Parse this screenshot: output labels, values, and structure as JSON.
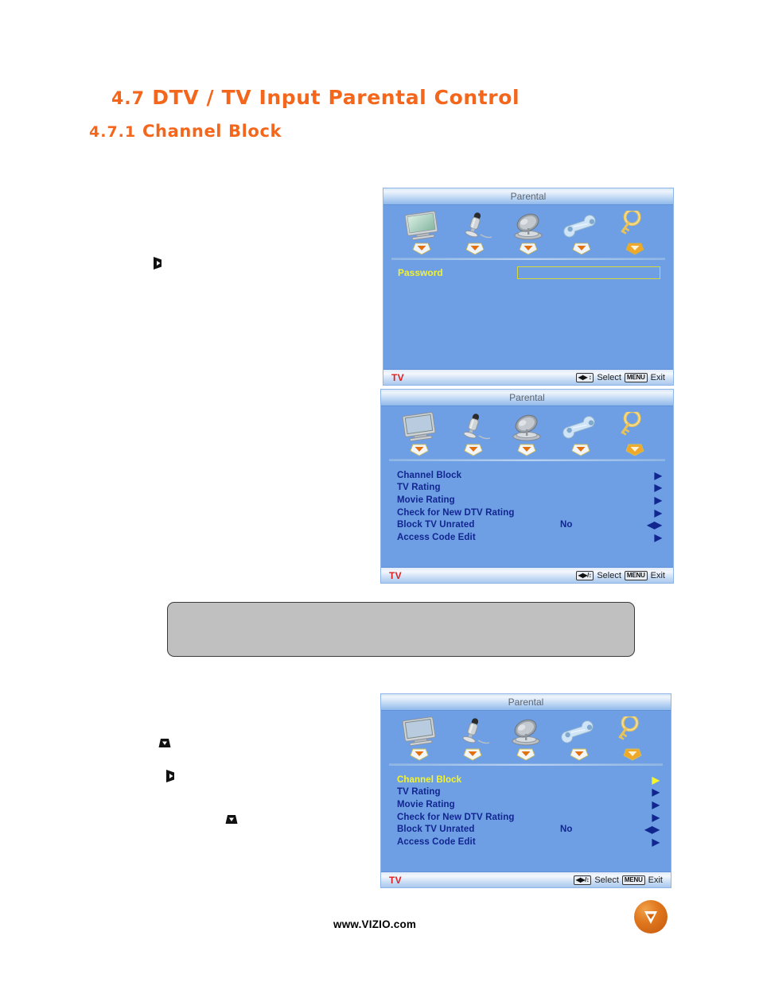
{
  "document": {
    "section_heading": {
      "number": "4.7",
      "text": "DTV / TV Input Parental Control"
    },
    "subsection_heading": {
      "number": "4.7.1",
      "text": "Channel Block"
    },
    "note_box_text": "",
    "footer": {
      "url": "www.VIZIO.com",
      "logo_letter": "V"
    }
  },
  "osd_panels": [
    {
      "id": "password-panel",
      "title": "Parental",
      "icons": [
        {
          "name": "tv-monitor-icon",
          "label": "TV"
        },
        {
          "name": "microphone-icon",
          "label": "Audio"
        },
        {
          "name": "satellite-dish-icon",
          "label": "Tuner"
        },
        {
          "name": "wrench-icon",
          "label": "Setup"
        },
        {
          "name": "key-icon",
          "label": "Parental",
          "selected": true
        }
      ],
      "password": {
        "label": "Password",
        "value": "",
        "placeholder": ""
      },
      "footer": {
        "source": "TV",
        "nav_key": "◀▶ ↕",
        "select": "Select",
        "menu_key": "MENU",
        "exit": "Exit"
      }
    },
    {
      "id": "parental-menu-panel",
      "title": "Parental",
      "icons": [
        {
          "name": "tv-monitor-icon",
          "label": "TV"
        },
        {
          "name": "microphone-icon",
          "label": "Audio"
        },
        {
          "name": "satellite-dish-icon",
          "label": "Tuner"
        },
        {
          "name": "wrench-icon",
          "label": "Setup"
        },
        {
          "name": "key-icon",
          "label": "Parental",
          "selected": true
        }
      ],
      "menu": [
        {
          "label": "Channel Block",
          "value": "",
          "arrow": "▶",
          "selected": false
        },
        {
          "label": "TV Rating",
          "value": "",
          "arrow": "▶",
          "selected": false
        },
        {
          "label": "Movie Rating",
          "value": "",
          "arrow": "▶",
          "selected": false
        },
        {
          "label": "Check for New DTV Rating",
          "value": "",
          "arrow": "▶",
          "selected": false
        },
        {
          "label": "Block TV Unrated",
          "value": "No",
          "arrow": "◀▶",
          "selected": false
        },
        {
          "label": "Access Code Edit",
          "value": "",
          "arrow": "▶",
          "selected": false
        }
      ],
      "footer": {
        "source": "TV",
        "nav_key": "◀▶/↕",
        "select": "Select",
        "menu_key": "MENU",
        "exit": "Exit"
      }
    },
    {
      "id": "parental-menu-highlighted-panel",
      "title": "Parental",
      "icons": [
        {
          "name": "tv-monitor-icon",
          "label": "TV"
        },
        {
          "name": "microphone-icon",
          "label": "Audio"
        },
        {
          "name": "satellite-dish-icon",
          "label": "Tuner"
        },
        {
          "name": "wrench-icon",
          "label": "Setup"
        },
        {
          "name": "key-icon",
          "label": "Parental",
          "selected": true
        }
      ],
      "menu": [
        {
          "label": "Channel Block",
          "value": "",
          "arrow": "▶",
          "selected": true
        },
        {
          "label": "TV Rating",
          "value": "",
          "arrow": "▶",
          "selected": false
        },
        {
          "label": "Movie Rating",
          "value": "",
          "arrow": "▶",
          "selected": false
        },
        {
          "label": "Check for New DTV Rating",
          "value": "",
          "arrow": "▶",
          "selected": false
        },
        {
          "label": "Block TV Unrated",
          "value": "No",
          "arrow": "◀▶",
          "selected": false
        },
        {
          "label": "Access Code Edit",
          "value": "",
          "arrow": "▶",
          "selected": false
        }
      ],
      "footer": {
        "source": "TV",
        "nav_key": "◀▶/↕",
        "select": "Select",
        "menu_key": "MENU",
        "exit": "Exit"
      }
    }
  ],
  "remote_keys": [
    {
      "id": "key-right-1",
      "direction": "right"
    },
    {
      "id": "key-down-1",
      "direction": "down"
    },
    {
      "id": "key-right-2",
      "direction": "right"
    },
    {
      "id": "key-down-2",
      "direction": "down"
    }
  ],
  "colors": {
    "heading_orange": "#F4661B",
    "osd_blue": "#6E9EE4",
    "menu_text_blue": "#11268F",
    "highlight_yellow": "#F5F52A",
    "tv_red": "#E02020",
    "note_gray": "#C0C0C0"
  }
}
